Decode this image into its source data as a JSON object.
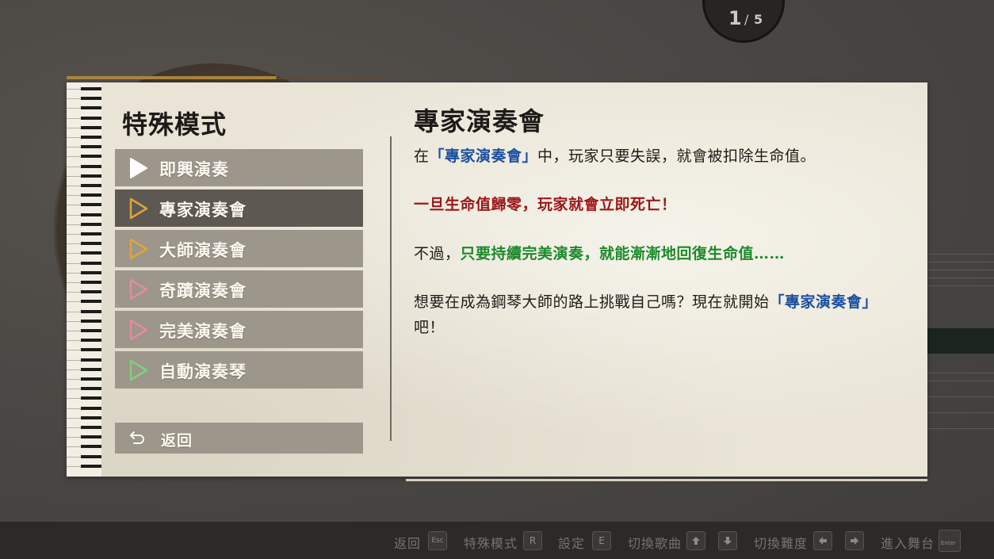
{
  "page_counter": {
    "current": "1",
    "separator": "/",
    "total": "5"
  },
  "sidebar": {
    "title": "特殊模式",
    "items": [
      {
        "label": "即興演奏",
        "icon": "play-triangle-icon",
        "icon_color": "#ffffff",
        "filled": true
      },
      {
        "label": "專家演奏會",
        "icon": "play-triangle-icon",
        "icon_color": "#e0a33a",
        "selected": true
      },
      {
        "label": "大師演奏會",
        "icon": "play-triangle-icon",
        "icon_color": "#e0a33a"
      },
      {
        "label": "奇蹟演奏會",
        "icon": "play-triangle-icon",
        "icon_color": "#e58aa3"
      },
      {
        "label": "完美演奏會",
        "icon": "play-triangle-icon",
        "icon_color": "#e58aa3"
      },
      {
        "label": "自動演奏琴",
        "icon": "play-triangle-icon",
        "icon_color": "#7fd07a"
      }
    ],
    "back": {
      "label": "返回",
      "icon": "return-arrow-icon"
    }
  },
  "content": {
    "title": "專家演奏會",
    "p1": {
      "a": "在",
      "b": "「專家演奏會」",
      "c": "中，玩家只要失誤，就會被扣除生命值。"
    },
    "p2": "一旦生命值歸零，玩家就會立即死亡！",
    "p3": {
      "a": "不過，",
      "b": "只要持續完美演奏，就能漸漸地回復生命值……"
    },
    "p4": {
      "a": "想要在成為鋼琴大師的路上挑戰自己嗎？現在就開始",
      "b": "「專家演奏會」",
      "c": "吧！"
    }
  },
  "hints": {
    "back": {
      "label": "返回",
      "key": "Esc"
    },
    "special_mode": {
      "label": "特殊模式",
      "key": "R"
    },
    "settings": {
      "label": "設定",
      "key": "E"
    },
    "switch_song": {
      "label": "切換歌曲"
    },
    "switch_difficulty": {
      "label": "切換難度"
    },
    "enter_stage": {
      "label": "進入舞台",
      "key": "Enter"
    }
  },
  "colors": {
    "emphasis_blue": "#1a4f9e",
    "warning_red": "#9c1618",
    "positive_green": "#1c8a2a",
    "menu_bg": "#9c968b",
    "menu_selected_bg": "#5d5851"
  }
}
